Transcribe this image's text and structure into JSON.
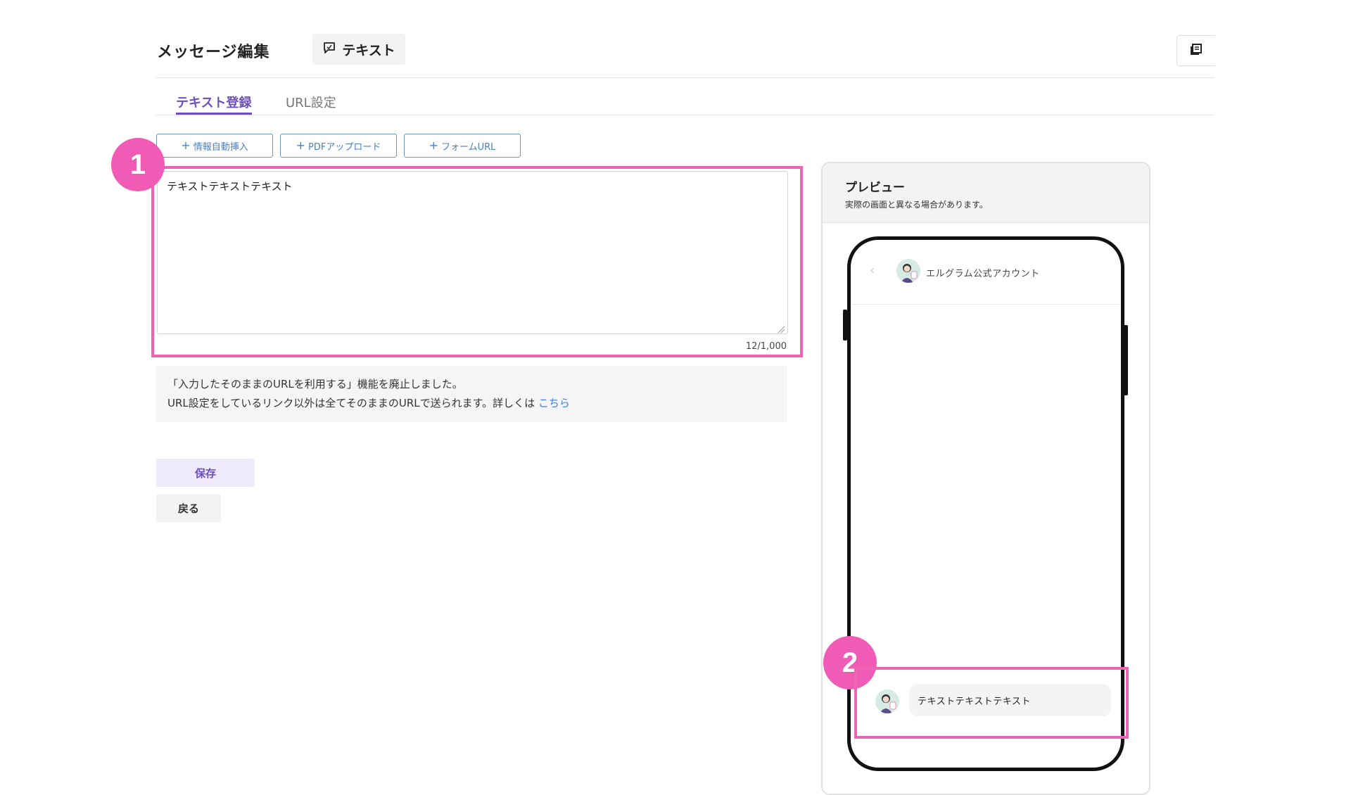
{
  "header": {
    "title": "メッセージ編集",
    "type_label": "テキスト",
    "type_icon": "chat-bubble-icon",
    "right_icon": "document-list-icon"
  },
  "tabs": [
    {
      "label": "テキスト登録",
      "active": true
    },
    {
      "label": "URL設定",
      "active": false
    }
  ],
  "actions": [
    {
      "label": "情報自動挿入"
    },
    {
      "label": "PDFアップロード"
    },
    {
      "label": "フォームURL"
    }
  ],
  "editor": {
    "value": "テキストテキストテキスト",
    "char_count": "12/1,000"
  },
  "badges": [
    "1",
    "2"
  ],
  "notice": {
    "line1": "「入力したそのままのURLを利用する」機能を廃止しました。",
    "line2": "URL設定をしているリンク以外は全てそのままのURLで送られます。詳しくは",
    "link": "こちら"
  },
  "buttons": {
    "save": "保存",
    "back": "戻る"
  },
  "preview": {
    "title": "プレビュー",
    "subtitle": "実際の画面と異なる場合があります。",
    "account_name": "エルグラム公式アカウント",
    "message": "テキストテキストテキスト"
  },
  "colors": {
    "accent": "#6d4fc2",
    "highlight": "#ee64b4",
    "link": "#3d84d4",
    "action_border": "#6b95c8"
  }
}
